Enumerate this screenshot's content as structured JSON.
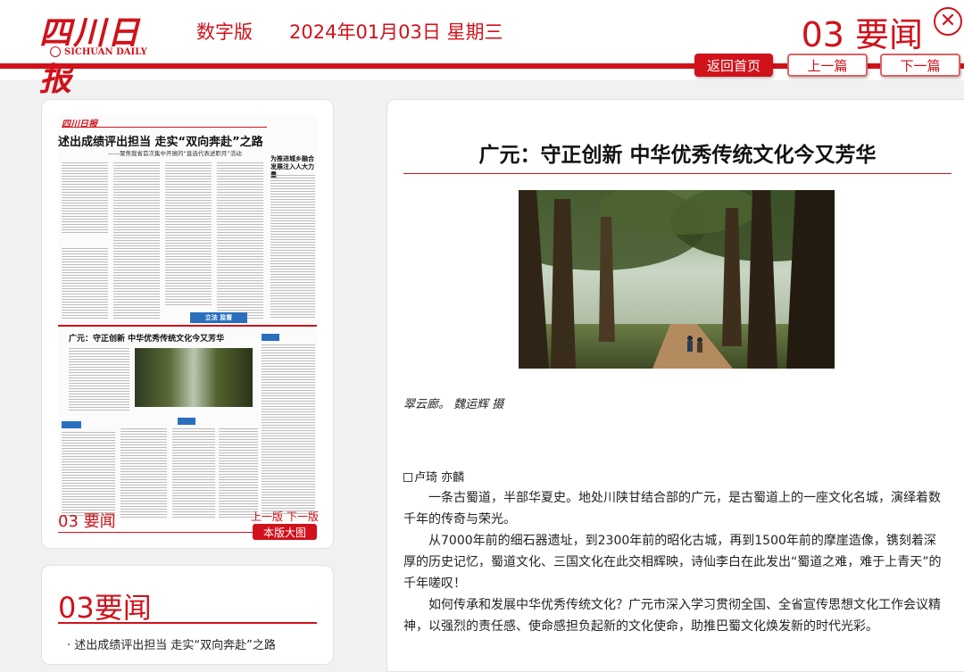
{
  "header": {
    "logo_text": "四川日报",
    "logo_sub": "SICHUAN DAILY",
    "edition": "数字版",
    "date": "2024年01月03日 星期三",
    "page_label": "03 要闻",
    "close_glyph": "✕",
    "nav": {
      "home": "返回首页",
      "prev": "上一篇",
      "next": "下一篇"
    }
  },
  "thumbnail": {
    "masthead": "四川日报",
    "headline_top": "述出成绩评出担当  走实“双向奔赴”之路",
    "subheadline_top": "——聚焦我省首次集中开展的“直选代表述职月”活动",
    "side_headline": "为推进城乡融合发展注入人大力量",
    "badge": "立法  监督",
    "headline_mid": "广元：守正创新  中华优秀传统文化今又芳华",
    "footer_label": "03 要闻",
    "prev_page": "上一版",
    "next_page": "下一版",
    "big_page_button": "本版大图"
  },
  "list": {
    "title": "03要闻",
    "items": [
      "· 述出成绩评出担当 走实“双向奔赴”之路"
    ]
  },
  "article": {
    "title": "广元：守正创新 中华优秀传统文化今又芳华",
    "caption": "翠云廊。  魏运辉 摄",
    "byline": "卢琦  亦麟",
    "paragraphs": [
      "一条古蜀道，半部华夏史。地处川陕甘结合部的广元，是古蜀道上的一座文化名城，演绎着数千年的传奇与荣光。",
      "从7000年前的细石器遗址，到2300年前的昭化古城，再到1500年前的摩崖造像，镌刻着深厚的历史记忆，蜀道文化、三国文化在此交相辉映，诗仙李白在此发出“蜀道之难，难于上青天”的千年嗟叹！",
      "如何传承和发展中华优秀传统文化？广元市深入学习贯彻全国、全省宣传思想文化工作会议精神，以强烈的责任感、使命感担负起新的文化使命，助推巴蜀文化焕发新的时代光彩。"
    ]
  },
  "colors": {
    "brand_red": "#d0121b",
    "accent_blue": "#2a6fbd"
  },
  "icons": {
    "close": "close-icon",
    "emblem": "emblem-icon"
  }
}
